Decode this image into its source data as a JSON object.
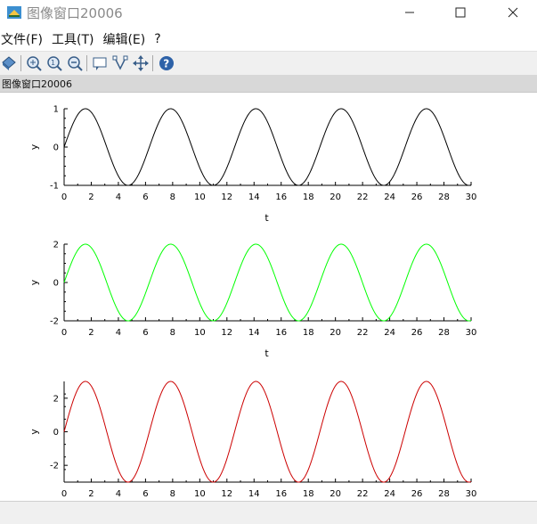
{
  "window": {
    "title": "图像窗口20006",
    "controls": [
      "minimize",
      "maximize",
      "close"
    ]
  },
  "menu": [
    {
      "label": "文件(F)"
    },
    {
      "label": "工具(T)"
    },
    {
      "label": "编辑(E)"
    },
    {
      "label": "?"
    }
  ],
  "toolbar": {
    "icons": [
      "rotate-3d-icon",
      "zoom-area-icon",
      "zoom-in-icon",
      "zoom-out-icon",
      "datatip-icon",
      "datatip-edit-icon",
      "pan-icon",
      "help-icon"
    ]
  },
  "figure_tab": {
    "label": "图像窗口20006"
  },
  "colors": {
    "black": "#000000",
    "green": "#00ff00",
    "red": "#cc0000"
  },
  "chart_data": [
    {
      "type": "line",
      "xlabel": "t",
      "ylabel": "y",
      "xlim": [
        0,
        30
      ],
      "ylim": [
        -1,
        1
      ],
      "x_ticks": [
        "0",
        "2",
        "4",
        "6",
        "8",
        "10",
        "12",
        "14",
        "16",
        "18",
        "20",
        "22",
        "24",
        "26",
        "28",
        "30"
      ],
      "y_ticks": [
        "-1",
        "0",
        "1"
      ],
      "series": [
        {
          "color": "#000000",
          "amplitude": 1,
          "function": "sin(t)",
          "x_range": [
            0,
            30
          ]
        }
      ]
    },
    {
      "type": "line",
      "xlabel": "t",
      "ylabel": "y",
      "xlim": [
        0,
        30
      ],
      "ylim": [
        -2,
        2
      ],
      "x_ticks": [
        "0",
        "2",
        "4",
        "6",
        "8",
        "10",
        "12",
        "14",
        "16",
        "18",
        "20",
        "22",
        "24",
        "26",
        "28",
        "30"
      ],
      "y_ticks": [
        "-2",
        "0",
        "2"
      ],
      "series": [
        {
          "color": "#00ff00",
          "amplitude": 2,
          "function": "2*sin(t)",
          "x_range": [
            0,
            30
          ]
        }
      ]
    },
    {
      "type": "line",
      "xlabel": "",
      "ylabel": "y",
      "xlim": [
        0,
        30
      ],
      "ylim": [
        -3,
        3
      ],
      "x_ticks": [
        "0",
        "2",
        "4",
        "6",
        "8",
        "10",
        "12",
        "14",
        "16",
        "18",
        "20",
        "22",
        "24",
        "26",
        "28",
        "30"
      ],
      "y_ticks": [
        "-2",
        "0",
        "2"
      ],
      "series": [
        {
          "color": "#cc0000",
          "amplitude": 3,
          "function": "3*sin(t)",
          "x_range": [
            0,
            30
          ]
        }
      ]
    }
  ]
}
